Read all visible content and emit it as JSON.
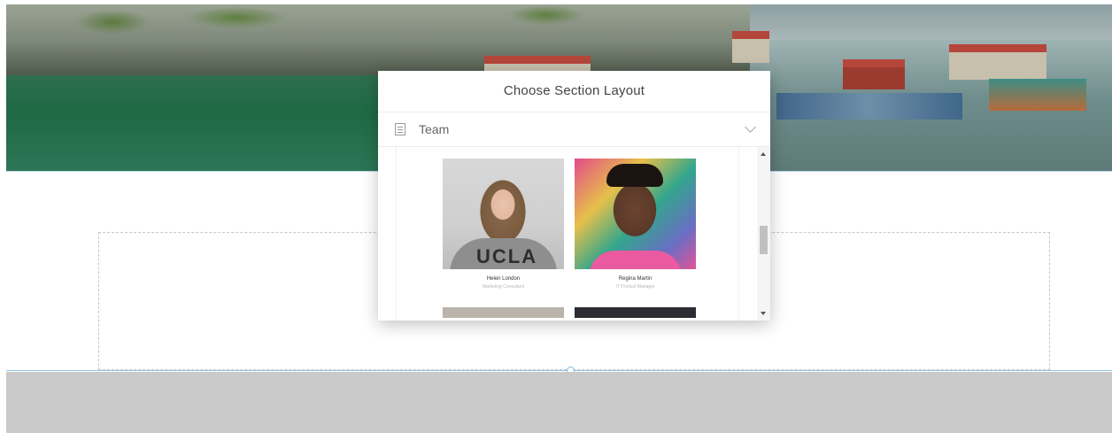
{
  "modal": {
    "title": "Choose Section Layout",
    "select": {
      "value": "Team",
      "icon": "layout-icon"
    }
  },
  "cards": [
    {
      "name": "Helen London",
      "role": "Marketing Consultant"
    },
    {
      "name": "Regina Martin",
      "role": "IT Product Manager"
    }
  ],
  "hero": {
    "photo_shirt_text": "UCLA"
  },
  "colors": {
    "accent_line": "#8fc3e6",
    "footer_band": "#cacaca",
    "dropzone_border": "#c6c6c6"
  },
  "scrollbar": {
    "position_fraction": 0.55
  }
}
